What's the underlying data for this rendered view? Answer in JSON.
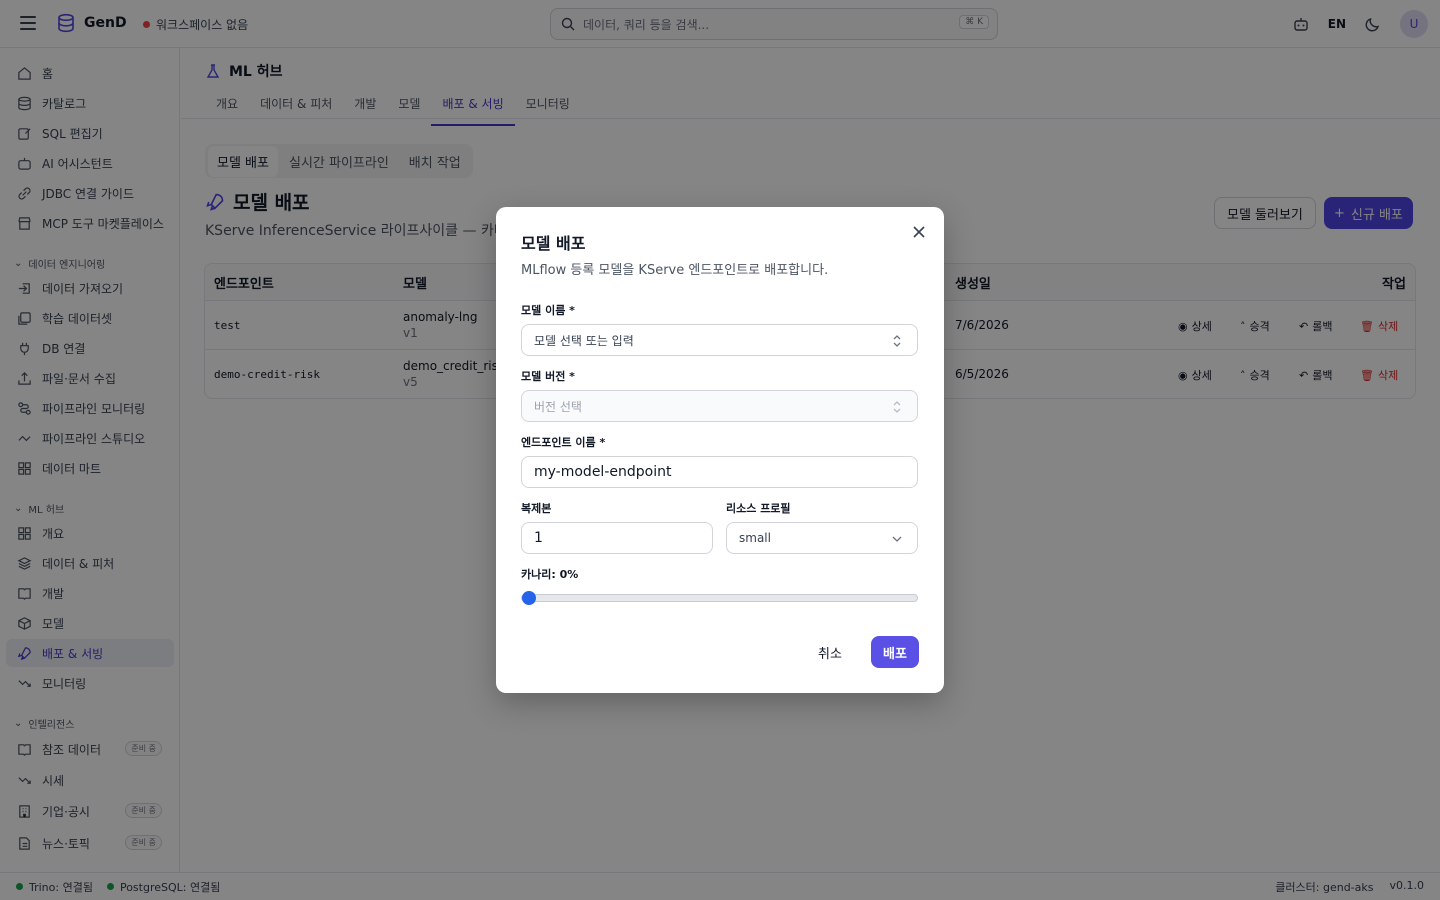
{
  "app": {
    "name": "GenD",
    "workspace": "워크스페이스 없음"
  },
  "search": {
    "placeholder": "데이터, 쿼리 등을 검색...",
    "shortcut": "⌘ K"
  },
  "topbar": {
    "lang": "EN",
    "avatar_initial": "U"
  },
  "sidebar": {
    "main_items": [
      "홈",
      "카탈로그",
      "SQL 편집기",
      "AI 어시스턴트",
      "JDBC 연결 가이드",
      "MCP 도구 마켓플레이스"
    ],
    "section_data_eng": "데이터 엔지니어링",
    "data_eng_items": [
      "데이터 가져오기",
      "학습 데이터셋",
      "DB 연결",
      "파일·문서 수집",
      "파이프라인 모니터링",
      "파이프라인 스튜디오",
      "데이터 마트"
    ],
    "section_ml": "ML 허브",
    "ml_items": [
      "개요",
      "데이터 & 피처",
      "개발",
      "모델",
      "배포 & 서빙",
      "모니터링"
    ],
    "section_intel": "인텔리전스",
    "intel_items": [
      "참조 데이터",
      "시세",
      "기업·공시",
      "뉴스·토픽"
    ],
    "soon_badge": "준비 중"
  },
  "main": {
    "hub_title": "ML 허브",
    "tabs": [
      "개요",
      "데이터 & 피처",
      "개발",
      "모델",
      "배포 & 서빙",
      "모니터링"
    ],
    "subtabs": [
      "모델 배포",
      "실시간 파이프라인",
      "배치 작업"
    ],
    "page_title": "모델 배포",
    "page_desc": "KServe InferenceService 라이프사이클 — 카나리",
    "browse_button": "모델 둘러보기",
    "new_button": "신규 배포",
    "table": {
      "headers": {
        "endpoint": "엔드포인트",
        "model": "모델",
        "created": "생성일",
        "actions": "작업"
      },
      "rows": [
        {
          "endpoint": "test",
          "model": "anomaly-lng",
          "version": "v1",
          "created": "7/6/2026"
        },
        {
          "endpoint": "demo-credit-risk",
          "model": "demo_credit_ris",
          "version": "v5",
          "created": "6/5/2026"
        }
      ],
      "actions": {
        "detail": "상세",
        "promote": "승격",
        "rollback": "롤백",
        "delete": "삭제"
      }
    }
  },
  "dialog": {
    "title": "모델 배포",
    "description": "MLflow 등록 모델을 KServe 엔드포인트로 배포합니다.",
    "model_name_label": "모델 이름 *",
    "model_name_placeholder": "모델 선택 또는 입력",
    "model_version_label": "모델 버전 *",
    "model_version_placeholder": "버전 선택",
    "endpoint_label": "엔드포인트 이름 *",
    "endpoint_value": "my-model-endpoint",
    "replicas_label": "복제본",
    "replicas_value": "1",
    "resource_label": "리소스 프로필",
    "resource_value": "small",
    "canary_label": "카나리: 0%",
    "canary_percent": 0,
    "cancel": "취소",
    "submit": "배포"
  },
  "status": {
    "trino": "Trino: 연결됨",
    "postgres": "PostgreSQL: 연결됨",
    "cluster": "클러스터: gend-aks",
    "version": "v0.1.0"
  },
  "colors": {
    "accent": "#4f46e5",
    "danger": "#dc2626",
    "ok": "#16a34a"
  }
}
